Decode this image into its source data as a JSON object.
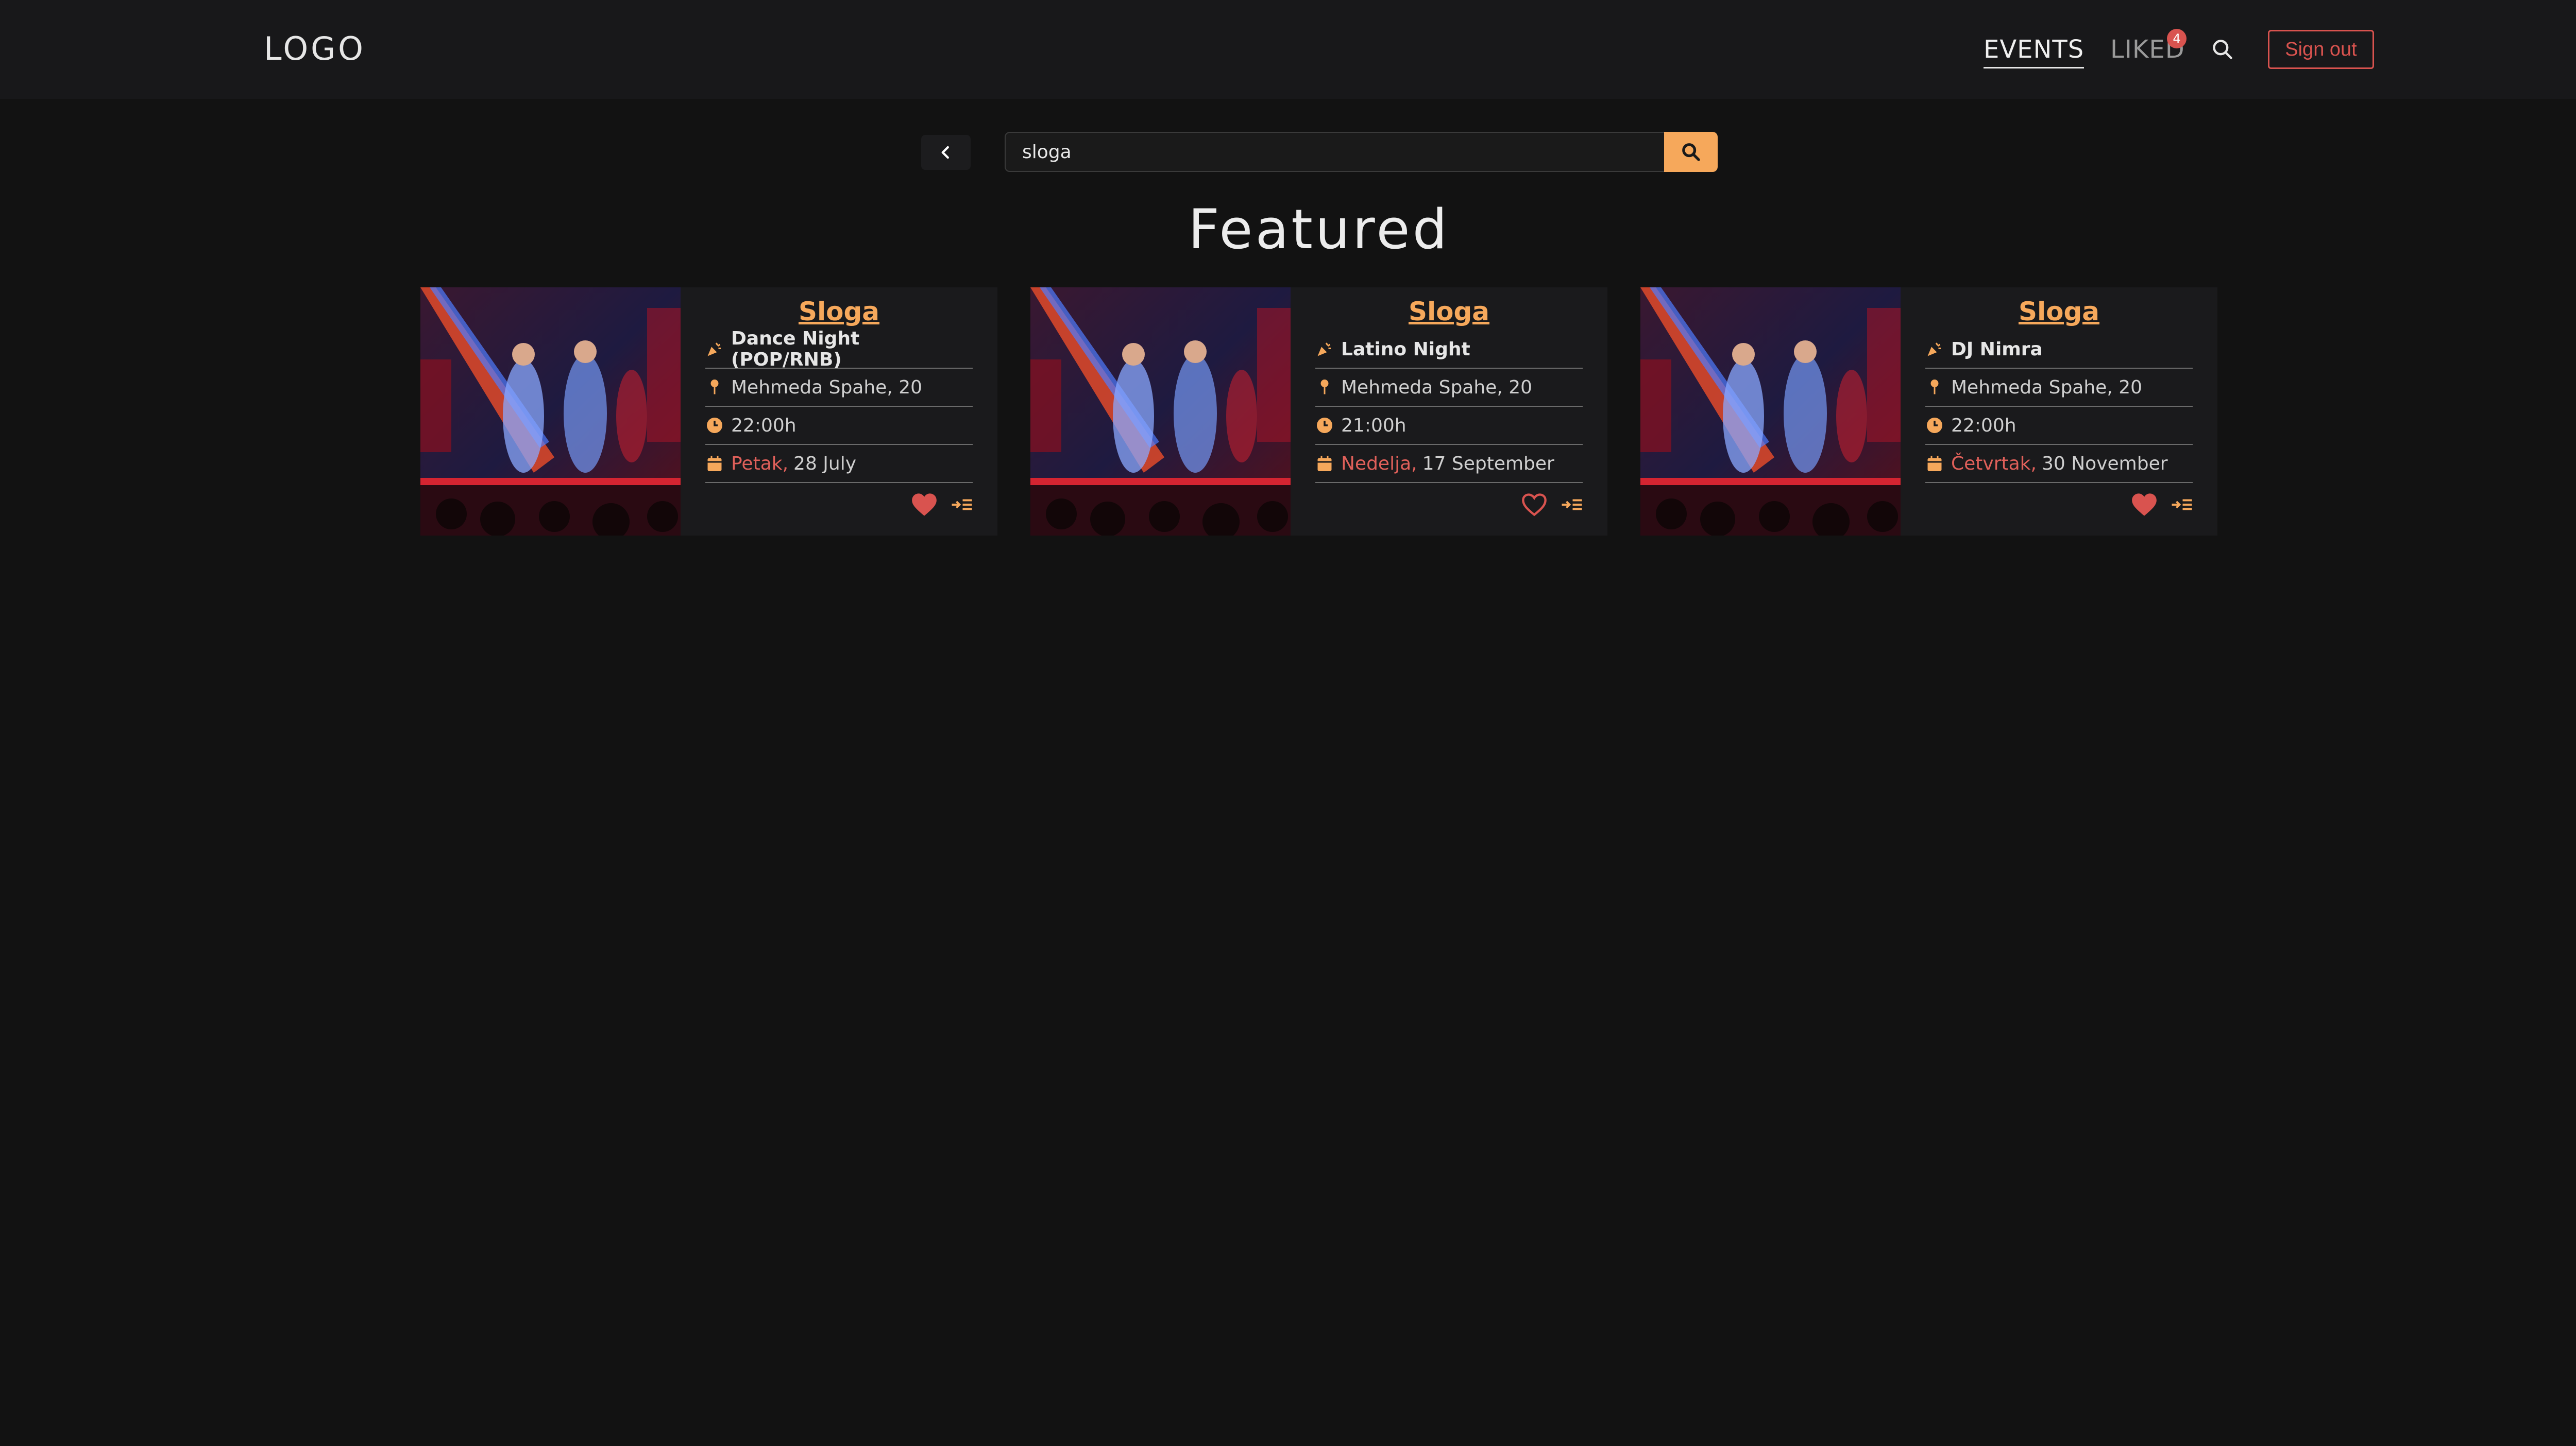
{
  "header": {
    "logo": "LOGO",
    "nav": {
      "events": "EVENTS",
      "liked": "LIKED",
      "liked_count": "4"
    },
    "signout": "Sign out"
  },
  "search": {
    "value": "sloga"
  },
  "featured_title": "Featured",
  "colors": {
    "accent": "#f6a85b",
    "danger": "#d9534f",
    "background": "#121212",
    "card": "#1a1a1c"
  },
  "cards": [
    {
      "title": "Sloga",
      "event": "Dance Night (POP/RNB)",
      "address": "Mehmeda Spahe, 20",
      "time": "22:00h",
      "day": "Petak,",
      "date": "28 July",
      "liked": true
    },
    {
      "title": "Sloga",
      "event": "Latino Night",
      "address": "Mehmeda Spahe, 20",
      "time": "21:00h",
      "day": "Nedelja,",
      "date": "17 September",
      "liked": false
    },
    {
      "title": "Sloga",
      "event": "DJ Nimra",
      "address": "Mehmeda Spahe, 20",
      "time": "22:00h",
      "day": "Četvrtak,",
      "date": "30 November",
      "liked": true
    }
  ]
}
